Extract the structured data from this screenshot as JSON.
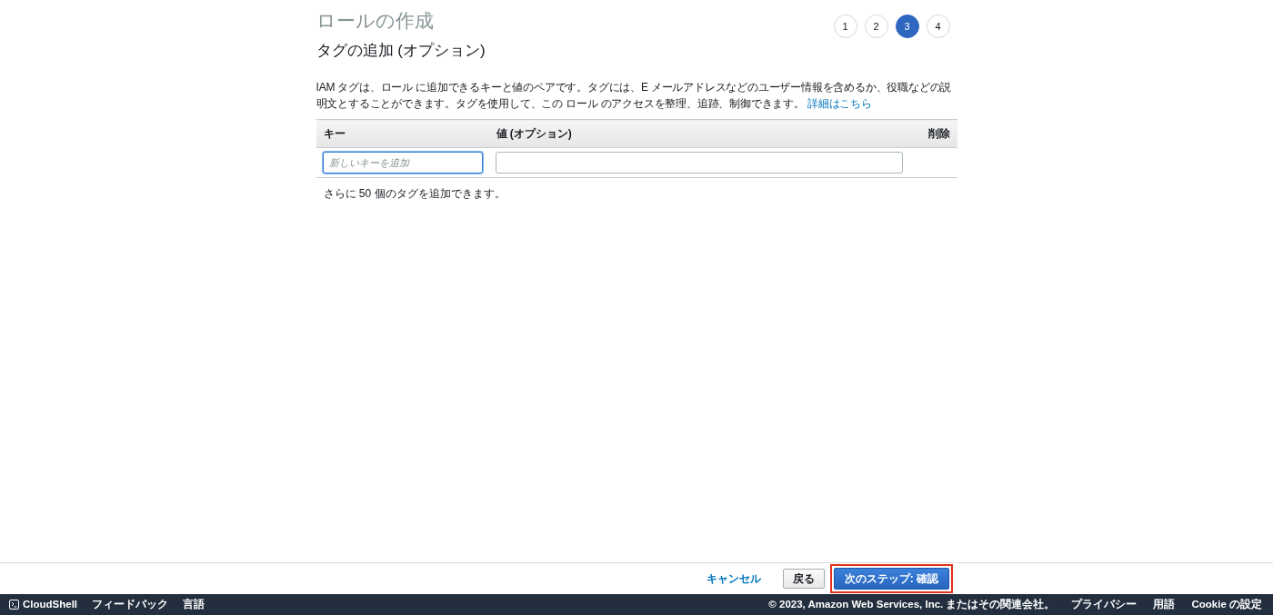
{
  "page_title": "ロールの作成",
  "steps": [
    {
      "label": "1",
      "selected": false
    },
    {
      "label": "2",
      "selected": false
    },
    {
      "label": "3",
      "selected": true
    },
    {
      "label": "4",
      "selected": false
    }
  ],
  "section_title": "タグの追加 (オプション)",
  "description": {
    "text": "IAM タグは、ロール に追加できるキーと値のペアです。タグには、E メールアドレスなどのユーザー情報を含めるか、役職などの説明文とすることができます。タグを使用して、この ロール のアクセスを整理、追跡、制御できます。",
    "link": "詳細はこちら"
  },
  "table": {
    "columns": [
      "キー",
      "値 (オプション)",
      "削除"
    ],
    "rows": [
      {
        "key": {
          "placeholder": "新しいキーを追加",
          "focused": true
        },
        "value": {
          "focused": false
        }
      }
    ]
  },
  "remaining_note": "さらに 50 個のタグを追加できます。",
  "actions": [
    {
      "kind": "link",
      "label": "キャンセル",
      "highlighted": false
    },
    {
      "kind": "secondary",
      "label": "戻る",
      "highlighted": false
    },
    {
      "kind": "primary",
      "label": "次のステップ: 確認",
      "highlighted": true
    }
  ],
  "footer": {
    "left": [
      "CloudShell",
      "フィードバック",
      "言語"
    ],
    "copyright": "© 2023, Amazon Web Services, Inc. またはその関連会社。",
    "right": [
      "プライバシー",
      "用語",
      "Cookie の設定"
    ]
  }
}
